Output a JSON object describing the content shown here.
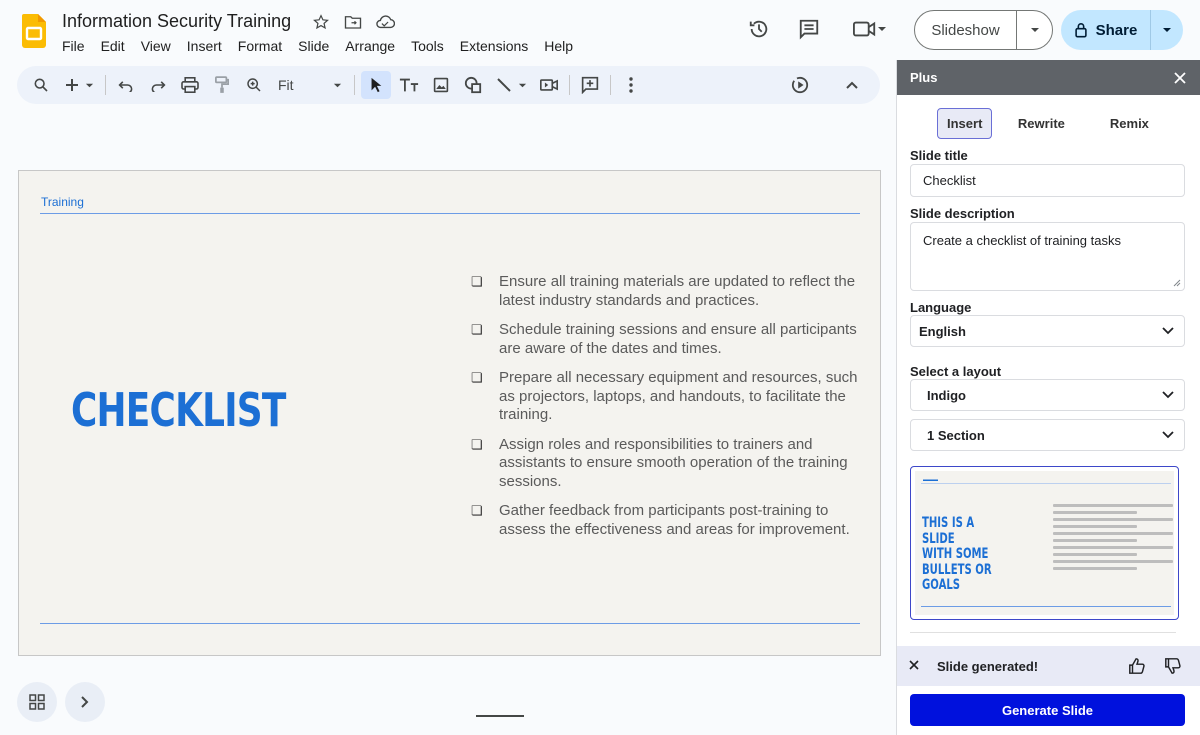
{
  "app": {
    "doc_title": "Information Security Training",
    "menu": [
      "File",
      "Edit",
      "View",
      "Insert",
      "Format",
      "Slide",
      "Arrange",
      "Tools",
      "Extensions",
      "Help"
    ]
  },
  "header": {
    "slideshow_label": "Slideshow",
    "share_label": "Share",
    "colors": {
      "share_bg": "#c2e7ff",
      "logo": "#fbbc04"
    }
  },
  "toolbar": {
    "zoom_value": "Fit"
  },
  "slide": {
    "section_label": "Training",
    "title": "CHECKLIST",
    "items": [
      "Ensure all training materials are updated to reflect the latest industry standards and practices.",
      "Schedule training sessions and ensure all participants are aware of the dates and times.",
      "Prepare all necessary equipment and resources, such as projectors, laptops, and handouts, to facilitate the training.",
      "Assign roles and responsibilities to trainers and assistants to ensure smooth operation of the training sessions.",
      "Gather feedback from participants post-training to assess the effectiveness and areas for improvement."
    ],
    "bullet_glyph": "❏",
    "colors": {
      "accent": "#1c6fd4",
      "background": "#f4f3ef"
    }
  },
  "panel": {
    "title": "Plus",
    "tabs": [
      "Insert",
      "Rewrite",
      "Remix"
    ],
    "active_tab": "Insert",
    "slide_title_label": "Slide title",
    "slide_title_value": "Checklist",
    "slide_description_label": "Slide description",
    "slide_description_value": "Create a checklist of training tasks",
    "language_label": "Language",
    "language_value": "English",
    "layout_label": "Select a layout",
    "layout_value": "Indigo",
    "section_value": "1 Section",
    "preview": {
      "title": "THIS IS A SLIDE\nWITH SOME\nBULLETS OR\nGOALS"
    },
    "status_text": "Slide generated!",
    "generate_label": "Generate Slide",
    "colors": {
      "generate_bg": "#0011dd",
      "status_bg": "#e8eaf6"
    }
  }
}
